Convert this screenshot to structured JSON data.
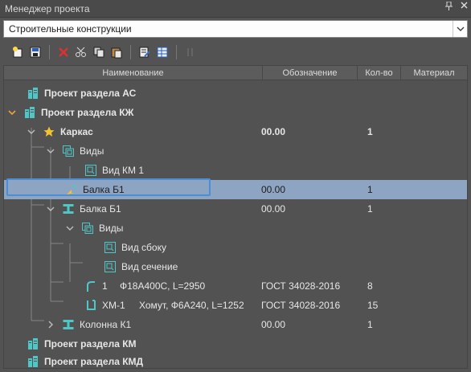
{
  "window": {
    "title": "Менеджер проекта",
    "pin_glyph": "ᵖ",
    "close_glyph": "×"
  },
  "dropdown": {
    "value": "Строительные конструкции"
  },
  "columns": {
    "name": "Наименование",
    "oboz": "Обозначение",
    "qty": "Кол-во",
    "material": "Материал"
  },
  "rows": [
    {
      "name": "Проект раздела АС",
      "oboz": "",
      "qty": "",
      "prefix": ""
    },
    {
      "name": "Проект раздела КЖ",
      "oboz": "",
      "qty": "",
      "prefix": ""
    },
    {
      "name": "Каркас",
      "oboz": "00.00",
      "qty": "1",
      "prefix": ""
    },
    {
      "name": "Виды",
      "oboz": "",
      "qty": "",
      "prefix": ""
    },
    {
      "name": "Вид КМ 1",
      "oboz": "",
      "qty": "",
      "prefix": ""
    },
    {
      "name": "Балка Б1",
      "oboz": "00.00",
      "qty": "1",
      "prefix": ""
    },
    {
      "name": "Балка Б1",
      "oboz": "00.00",
      "qty": "1",
      "prefix": ""
    },
    {
      "name": "Виды",
      "oboz": "",
      "qty": "",
      "prefix": ""
    },
    {
      "name": "Вид сбоку",
      "oboz": "",
      "qty": "",
      "prefix": ""
    },
    {
      "name": "Вид сечение",
      "oboz": "",
      "qty": "",
      "prefix": ""
    },
    {
      "name": "Ф18А400С, L=2950",
      "oboz": "ГОСТ 34028-2016",
      "qty": "8",
      "prefix": "1"
    },
    {
      "name": "Хомут, Ф6А240, L=1252",
      "oboz": "ГОСТ 34028-2016",
      "qty": "15",
      "prefix": "ХМ-1"
    },
    {
      "name": "Колонна К1",
      "oboz": "00.00",
      "qty": "1",
      "prefix": ""
    },
    {
      "name": "Проект раздела КМ",
      "oboz": "",
      "qty": "",
      "prefix": ""
    },
    {
      "name": "Проект раздела КМД",
      "oboz": "",
      "qty": "",
      "prefix": ""
    }
  ],
  "colors": {
    "selection": "#8ea4c3",
    "focus": "#4a8fd6",
    "accent_teal": "#4fc7c7",
    "star": "#f2c230"
  }
}
